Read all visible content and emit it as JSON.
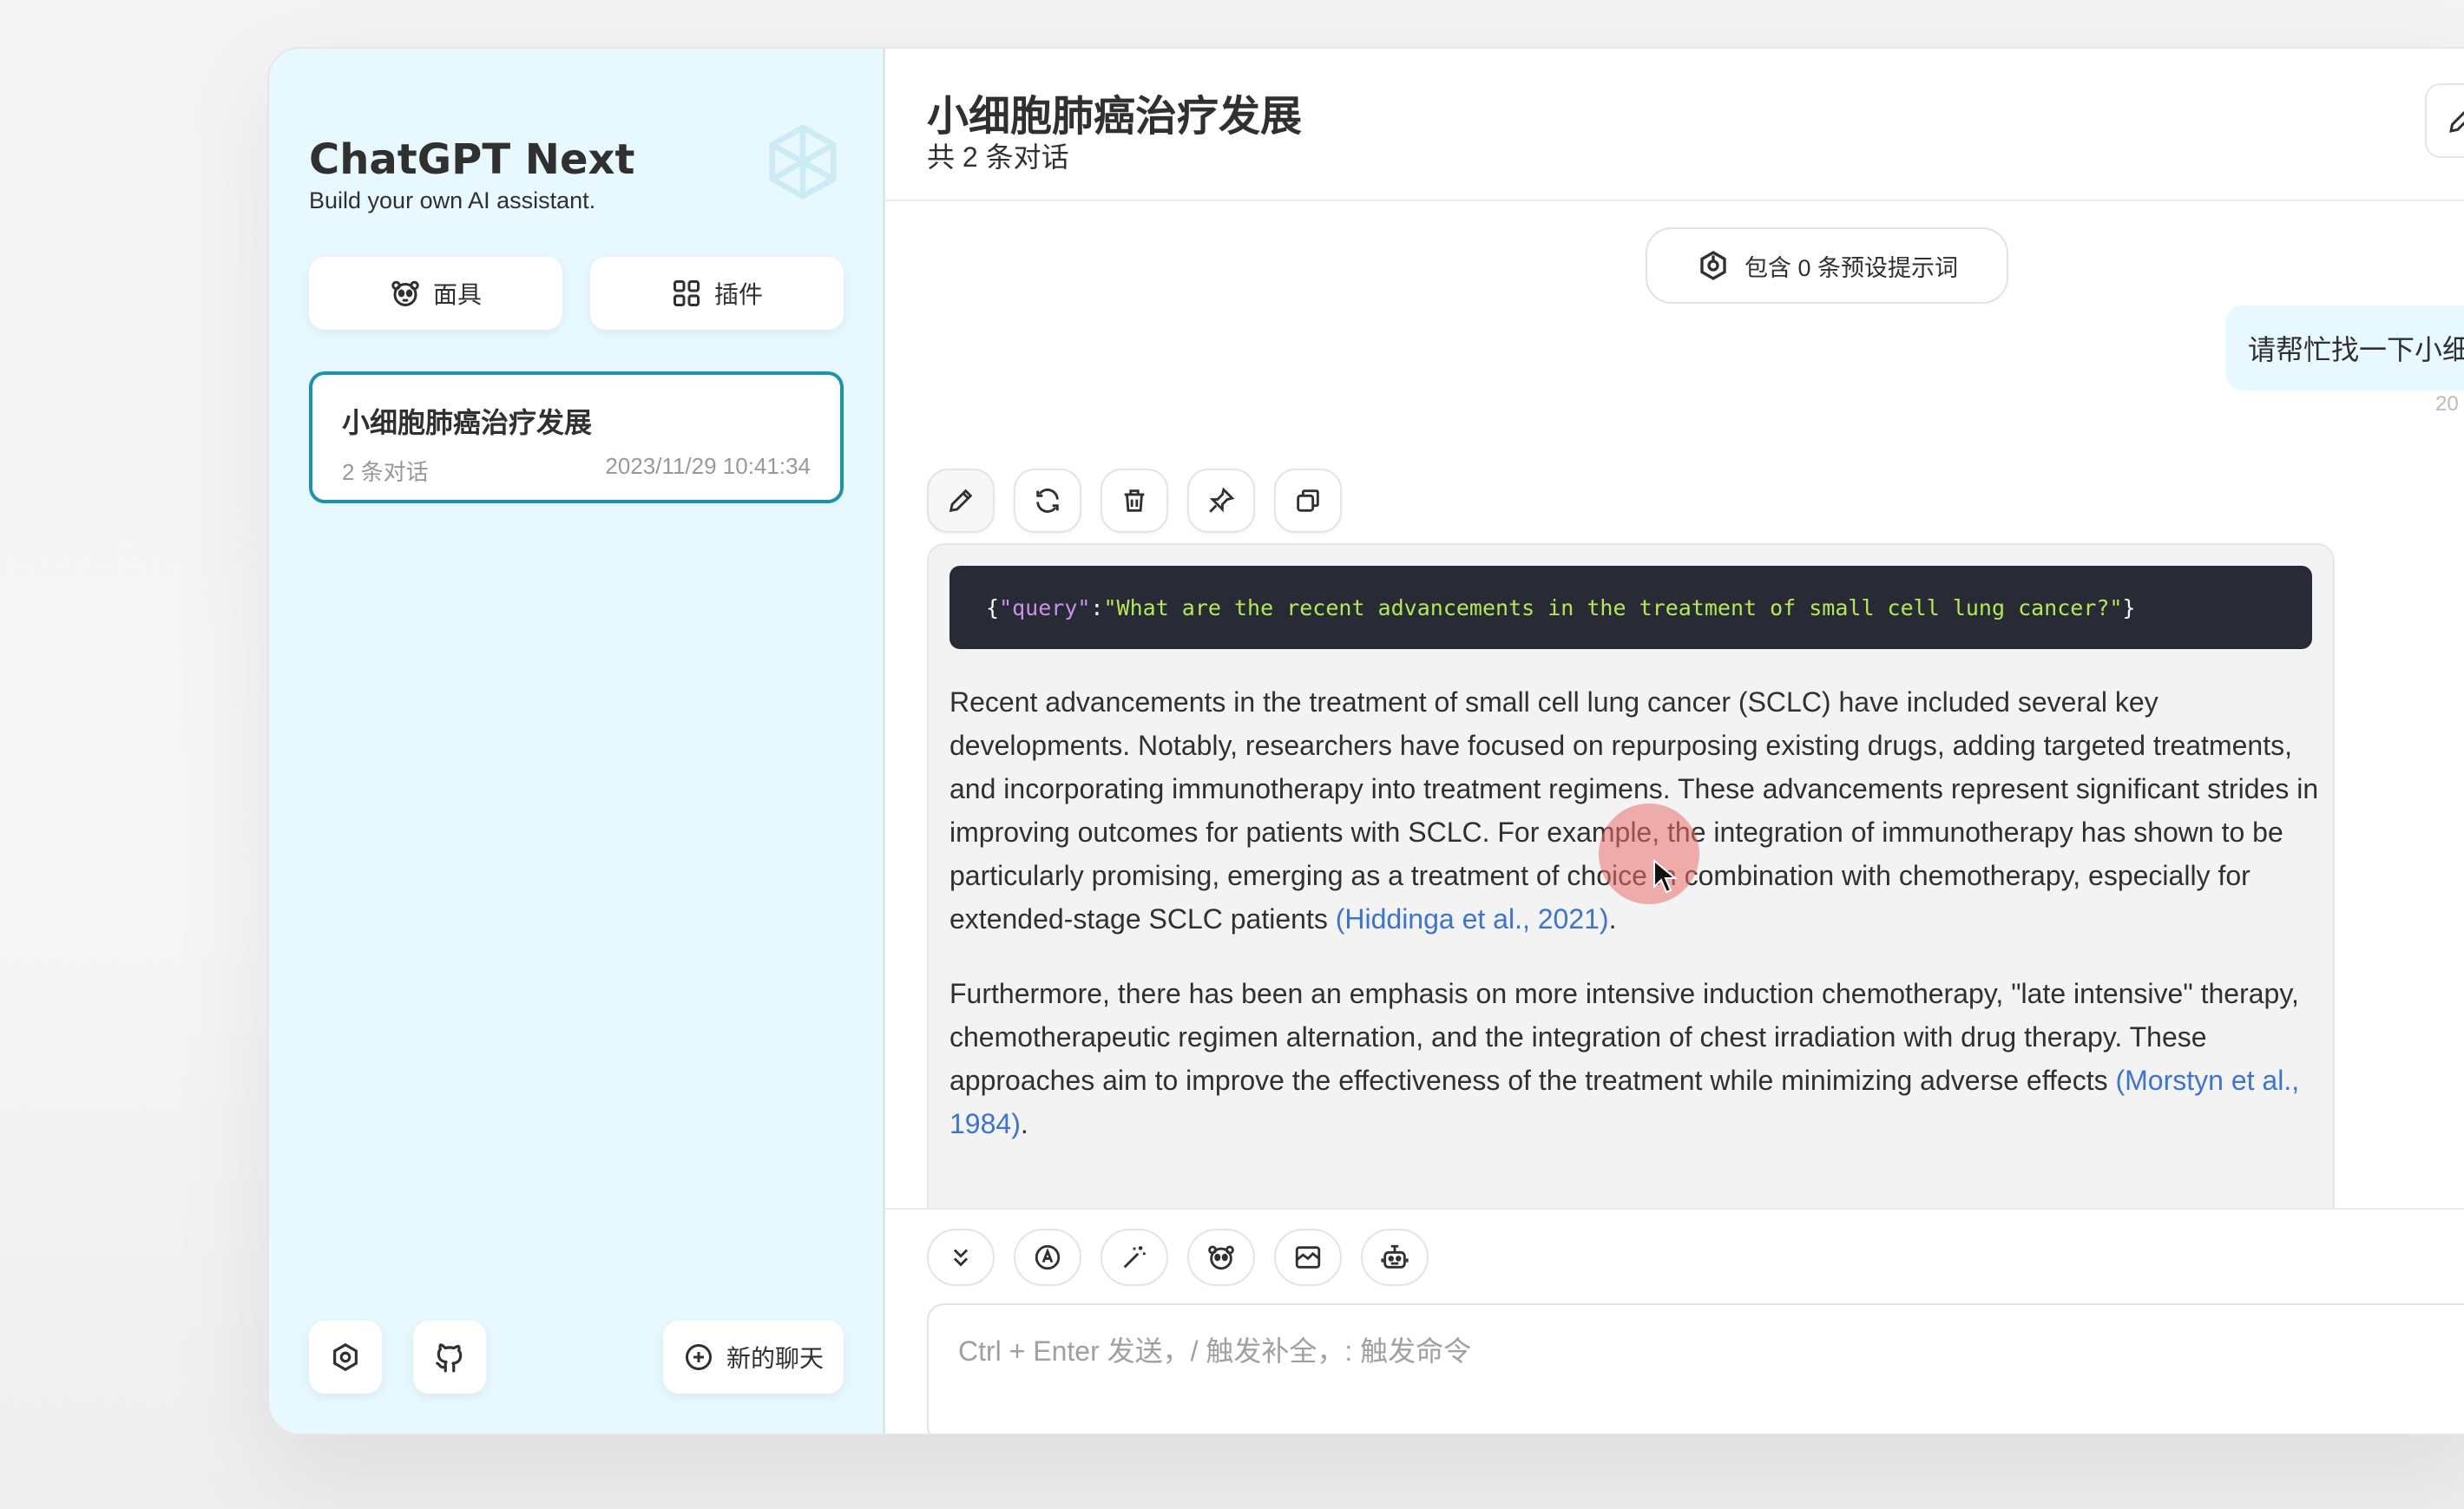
{
  "sidebar": {
    "app_title": "ChatGPT Next",
    "app_subtitle": "Build your own AI assistant.",
    "masks_label": "面具",
    "plugins_label": "插件",
    "chat_list": [
      {
        "title": "小细胞肺癌治疗发展",
        "count": "2 条对话",
        "date": "2023/11/29 10:41:34"
      }
    ],
    "new_chat_label": "新的聊天"
  },
  "header": {
    "title": "小细胞肺癌治疗发展",
    "subtitle": "共 2 条对话"
  },
  "chat": {
    "prompt_pill": "包含 0 条预设提示词",
    "user_message": "请帮忙找一下小细胞",
    "user_date": "20",
    "code": {
      "open": "{",
      "key": "\"query\"",
      "colon": ":",
      "value": "\"What are the recent advancements in the treatment of small cell lung cancer?\"",
      "close": "}"
    },
    "paragraph1": "Recent advancements in the treatment of small cell lung cancer (SCLC) have included several key developments. Notably, researchers have focused on repurposing existing drugs, adding targeted treatments, and incorporating immunotherapy into treatment regimens. These advancements represent significant strides in improving outcomes for patients with SCLC. For example, the integration of immunotherapy has shown to be particularly promising, emerging as a treatment of choice in combination with chemotherapy, especially for extended-stage SCLC patients ",
    "paragraph1_cite": "(Hiddinga et al., 2021)",
    "paragraph1_end": ".",
    "paragraph2": "Furthermore, there has been an emphasis on more intensive induction chemotherapy, \"late intensive\" therapy, chemotherapeutic regimen alternation, and the integration of chest irradiation with drug therapy. These approaches aim to improve the effectiveness of the treatment while minimizing adverse effects ",
    "paragraph2_cite": "(Morstyn et al., 1984)",
    "paragraph2_end": "."
  },
  "input": {
    "placeholder": "Ctrl + Enter 发送，/ 触发补全，: 触发命令"
  },
  "colors": {
    "sidebar_bg": "#e7f8ff",
    "accent": "#1d93ab",
    "link": "#3b73d6",
    "code_bg": "#282a36"
  }
}
